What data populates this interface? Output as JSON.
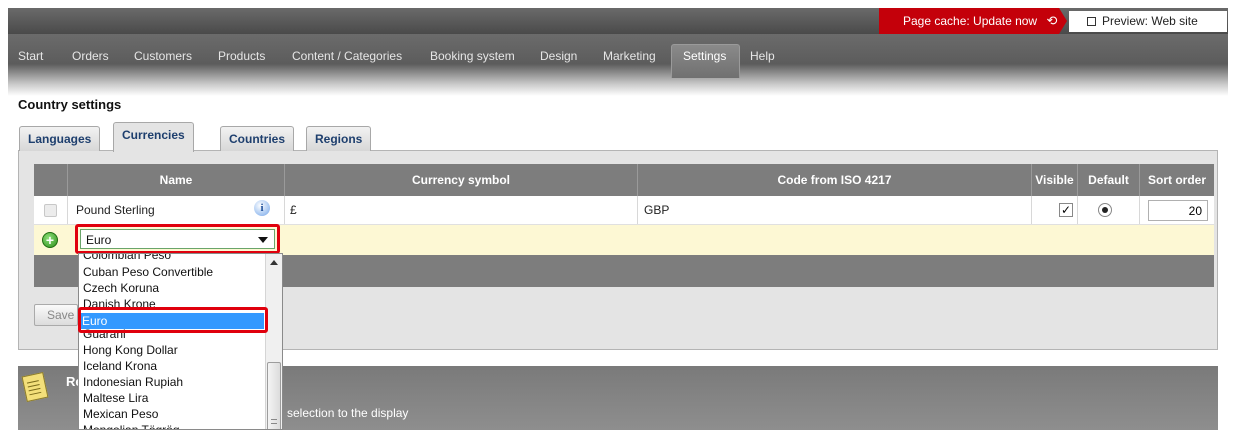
{
  "topbar": {
    "cache_label": "Page cache: Update now",
    "preview_label": "Preview: Web site"
  },
  "nav": {
    "items": [
      "Start",
      "Orders",
      "Customers",
      "Products",
      "Content / Categories",
      "Booking system",
      "Design",
      "Marketing",
      "Settings",
      "Help"
    ],
    "active": "Settings"
  },
  "page": {
    "heading": "Country settings"
  },
  "tabs": [
    "Languages",
    "Currencies",
    "Countries",
    "Regions"
  ],
  "active_tab": "Currencies",
  "table": {
    "columns": [
      "Name",
      "Currency symbol",
      "Code from ISO 4217",
      "Visible",
      "Default",
      "Sort order"
    ],
    "rows": [
      {
        "name": "Pound Sterling",
        "symbol": "£",
        "code": "GBP",
        "visible": true,
        "default": true,
        "sort_order": "20"
      }
    ],
    "new_row": {
      "selected_currency": "Euro"
    }
  },
  "dropdown": {
    "options": [
      "Colombian Peso",
      "Cuban Peso Convertible",
      "Czech Koruna",
      "Danish Krone",
      "Euro",
      "Guarani",
      "Hong Kong Dollar",
      "Iceland Krona",
      "Indonesian Rupiah",
      "Maltese Lira",
      "Mexican Peso",
      "Mongolian Tögrög"
    ],
    "selected": "Euro"
  },
  "save_label": "Save",
  "remarks": {
    "title": "Remarks",
    "text": "selection to the display"
  },
  "colors": {
    "accent_red": "#c4000a",
    "selection_blue": "#3399ff",
    "new_row_bg": "#fdf8d4",
    "highlight_red": "#e0000d"
  }
}
